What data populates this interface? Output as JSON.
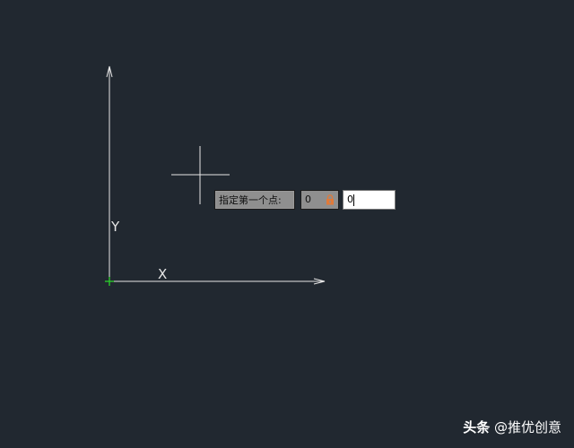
{
  "axes": {
    "y_label": "Y",
    "x_label": "X"
  },
  "colors": {
    "background": "#212830",
    "line": "#e6e6e6",
    "origin_marker": "#2bd12b",
    "lock": "#e07a3a"
  },
  "prompt": {
    "label": "指定第一个点:",
    "first_coordinate": "0",
    "second_coordinate_value": "0",
    "lock_icon": "padlock-icon"
  },
  "watermark": {
    "brand": "头条",
    "handle": "@推优创意"
  }
}
